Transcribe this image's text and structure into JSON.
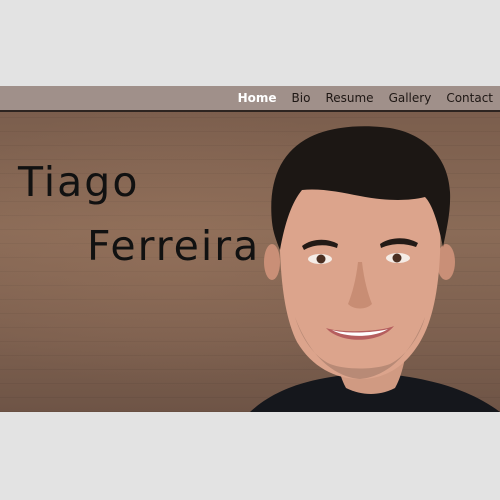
{
  "nav": {
    "items": [
      {
        "label": "Home",
        "active": true
      },
      {
        "label": "Bio",
        "active": false
      },
      {
        "label": "Resume",
        "active": false
      },
      {
        "label": "Gallery",
        "active": false
      },
      {
        "label": "Contact",
        "active": false
      }
    ]
  },
  "hero": {
    "first_name": "Tiago",
    "last_name": "Ferreira"
  },
  "colors": {
    "page_background": "#e3e3e3",
    "navbar": "#a0908a",
    "nav_active": "#ffffff",
    "nav_text": "#1e1714",
    "hero_background": "#7f6251",
    "name_text": "#111111"
  }
}
